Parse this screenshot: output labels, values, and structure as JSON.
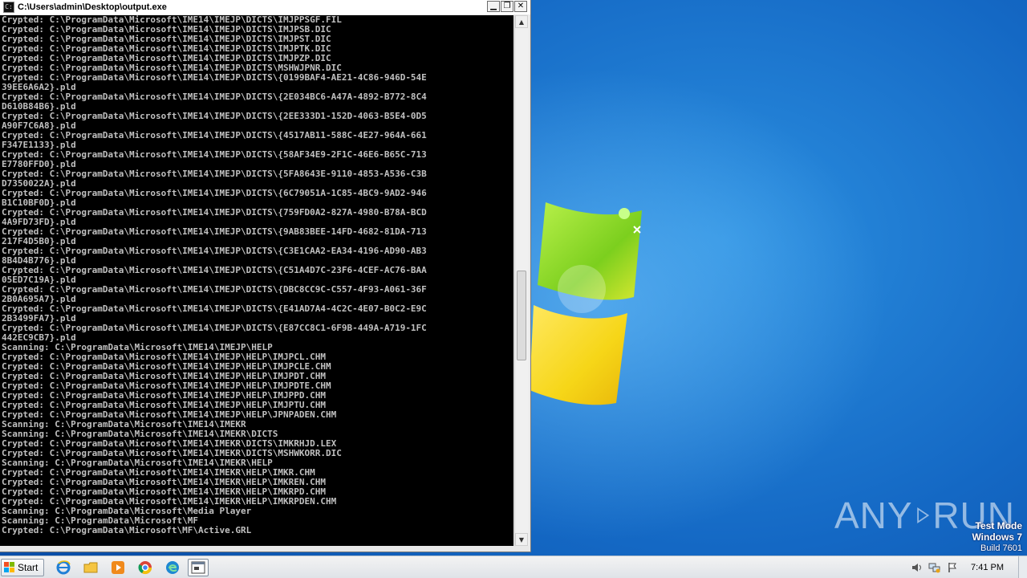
{
  "window": {
    "title": "C:\\Users\\admin\\Desktop\\output.exe",
    "minimize_glyph": "▁",
    "restore_glyph": "❐",
    "close_glyph": "✕"
  },
  "console_lines": [
    "Crypted: C:\\ProgramData\\Microsoft\\IME14\\IMEJP\\DICTS\\IMJPPSGF.FIL",
    "Crypted: C:\\ProgramData\\Microsoft\\IME14\\IMEJP\\DICTS\\IMJPSB.DIC",
    "Crypted: C:\\ProgramData\\Microsoft\\IME14\\IMEJP\\DICTS\\IMJPST.DIC",
    "Crypted: C:\\ProgramData\\Microsoft\\IME14\\IMEJP\\DICTS\\IMJPTK.DIC",
    "Crypted: C:\\ProgramData\\Microsoft\\IME14\\IMEJP\\DICTS\\IMJPZP.DIC",
    "Crypted: C:\\ProgramData\\Microsoft\\IME14\\IMEJP\\DICTS\\MSHWJPNR.DIC",
    "Crypted: C:\\ProgramData\\Microsoft\\IME14\\IMEJP\\DICTS\\{0199BAF4-AE21-4C86-946D-54E",
    "39EE6A6A2}.pld",
    "Crypted: C:\\ProgramData\\Microsoft\\IME14\\IMEJP\\DICTS\\{2E034BC6-A47A-4892-B772-8C4",
    "D610B84B6}.pld",
    "Crypted: C:\\ProgramData\\Microsoft\\IME14\\IMEJP\\DICTS\\{2EE333D1-152D-4063-B5E4-0D5",
    "A90F7C6A8}.pld",
    "Crypted: C:\\ProgramData\\Microsoft\\IME14\\IMEJP\\DICTS\\{4517AB11-588C-4E27-964A-661",
    "F347E1133}.pld",
    "Crypted: C:\\ProgramData\\Microsoft\\IME14\\IMEJP\\DICTS\\{58AF34E9-2F1C-46E6-B65C-713",
    "E7780FFD0}.pld",
    "Crypted: C:\\ProgramData\\Microsoft\\IME14\\IMEJP\\DICTS\\{5FA8643E-9110-4853-A536-C3B",
    "D7350022A}.pld",
    "Crypted: C:\\ProgramData\\Microsoft\\IME14\\IMEJP\\DICTS\\{6C79051A-1C85-4BC9-9AD2-946",
    "B1C10BF0D}.pld",
    "Crypted: C:\\ProgramData\\Microsoft\\IME14\\IMEJP\\DICTS\\{759FD0A2-827A-4980-B78A-BCD",
    "4A9FD73FD}.pld",
    "Crypted: C:\\ProgramData\\Microsoft\\IME14\\IMEJP\\DICTS\\{9AB83BEE-14FD-4682-81DA-713",
    "217F4D5B0}.pld",
    "Crypted: C:\\ProgramData\\Microsoft\\IME14\\IMEJP\\DICTS\\{C3E1CAA2-EA34-4196-AD90-AB3",
    "8B4D4B776}.pld",
    "Crypted: C:\\ProgramData\\Microsoft\\IME14\\IMEJP\\DICTS\\{C51A4D7C-23F6-4CEF-AC76-BAA",
    "05ED7C19A}.pld",
    "Crypted: C:\\ProgramData\\Microsoft\\IME14\\IMEJP\\DICTS\\{DBC8CC9C-C557-4F93-A061-36F",
    "2B0A695A7}.pld",
    "Crypted: C:\\ProgramData\\Microsoft\\IME14\\IMEJP\\DICTS\\{E41AD7A4-4C2C-4E07-B0C2-E9C",
    "2B3499FA7}.pld",
    "Crypted: C:\\ProgramData\\Microsoft\\IME14\\IMEJP\\DICTS\\{E87CC8C1-6F9B-449A-A719-1FC",
    "442EC9CB7}.pld",
    "Scanning: C:\\ProgramData\\Microsoft\\IME14\\IMEJP\\HELP",
    "Crypted: C:\\ProgramData\\Microsoft\\IME14\\IMEJP\\HELP\\IMJPCL.CHM",
    "Crypted: C:\\ProgramData\\Microsoft\\IME14\\IMEJP\\HELP\\IMJPCLE.CHM",
    "Crypted: C:\\ProgramData\\Microsoft\\IME14\\IMEJP\\HELP\\IMJPDT.CHM",
    "Crypted: C:\\ProgramData\\Microsoft\\IME14\\IMEJP\\HELP\\IMJPDTE.CHM",
    "Crypted: C:\\ProgramData\\Microsoft\\IME14\\IMEJP\\HELP\\IMJPPD.CHM",
    "Crypted: C:\\ProgramData\\Microsoft\\IME14\\IMEJP\\HELP\\IMJPTU.CHM",
    "Crypted: C:\\ProgramData\\Microsoft\\IME14\\IMEJP\\HELP\\JPNPADEN.CHM",
    "Scanning: C:\\ProgramData\\Microsoft\\IME14\\IMEKR",
    "Scanning: C:\\ProgramData\\Microsoft\\IME14\\IMEKR\\DICTS",
    "Crypted: C:\\ProgramData\\Microsoft\\IME14\\IMEKR\\DICTS\\IMKRHJD.LEX",
    "Crypted: C:\\ProgramData\\Microsoft\\IME14\\IMEKR\\DICTS\\MSHWKORR.DIC",
    "Scanning: C:\\ProgramData\\Microsoft\\IME14\\IMEKR\\HELP",
    "Crypted: C:\\ProgramData\\Microsoft\\IME14\\IMEKR\\HELP\\IMKR.CHM",
    "Crypted: C:\\ProgramData\\Microsoft\\IME14\\IMEKR\\HELP\\IMKREN.CHM",
    "Crypted: C:\\ProgramData\\Microsoft\\IME14\\IMEKR\\HELP\\IMKRPD.CHM",
    "Crypted: C:\\ProgramData\\Microsoft\\IME14\\IMEKR\\HELP\\IMKRPDEN.CHM",
    "Scanning: C:\\ProgramData\\Microsoft\\Media Player",
    "Scanning: C:\\ProgramData\\Microsoft\\MF",
    "Crypted: C:\\ProgramData\\Microsoft\\MF\\Active.GRL"
  ],
  "scrollbar": {
    "up_glyph": "▲",
    "down_glyph": "▼"
  },
  "desktop": {
    "watermark_line1": "Test Mode",
    "watermark_line2": "Windows 7",
    "watermark_line3": "Build 7601",
    "brand_left": "ANY",
    "brand_right": "RUN"
  },
  "taskbar": {
    "start_label": "Start",
    "icons": [
      "internet-explorer-icon",
      "file-explorer-icon",
      "media-player-icon",
      "chrome-icon",
      "edge-icon",
      "console-app-icon"
    ],
    "clock": "7:41 PM",
    "tray_icons": [
      "speaker-icon",
      "network-icon",
      "action-center-flag-icon"
    ]
  }
}
